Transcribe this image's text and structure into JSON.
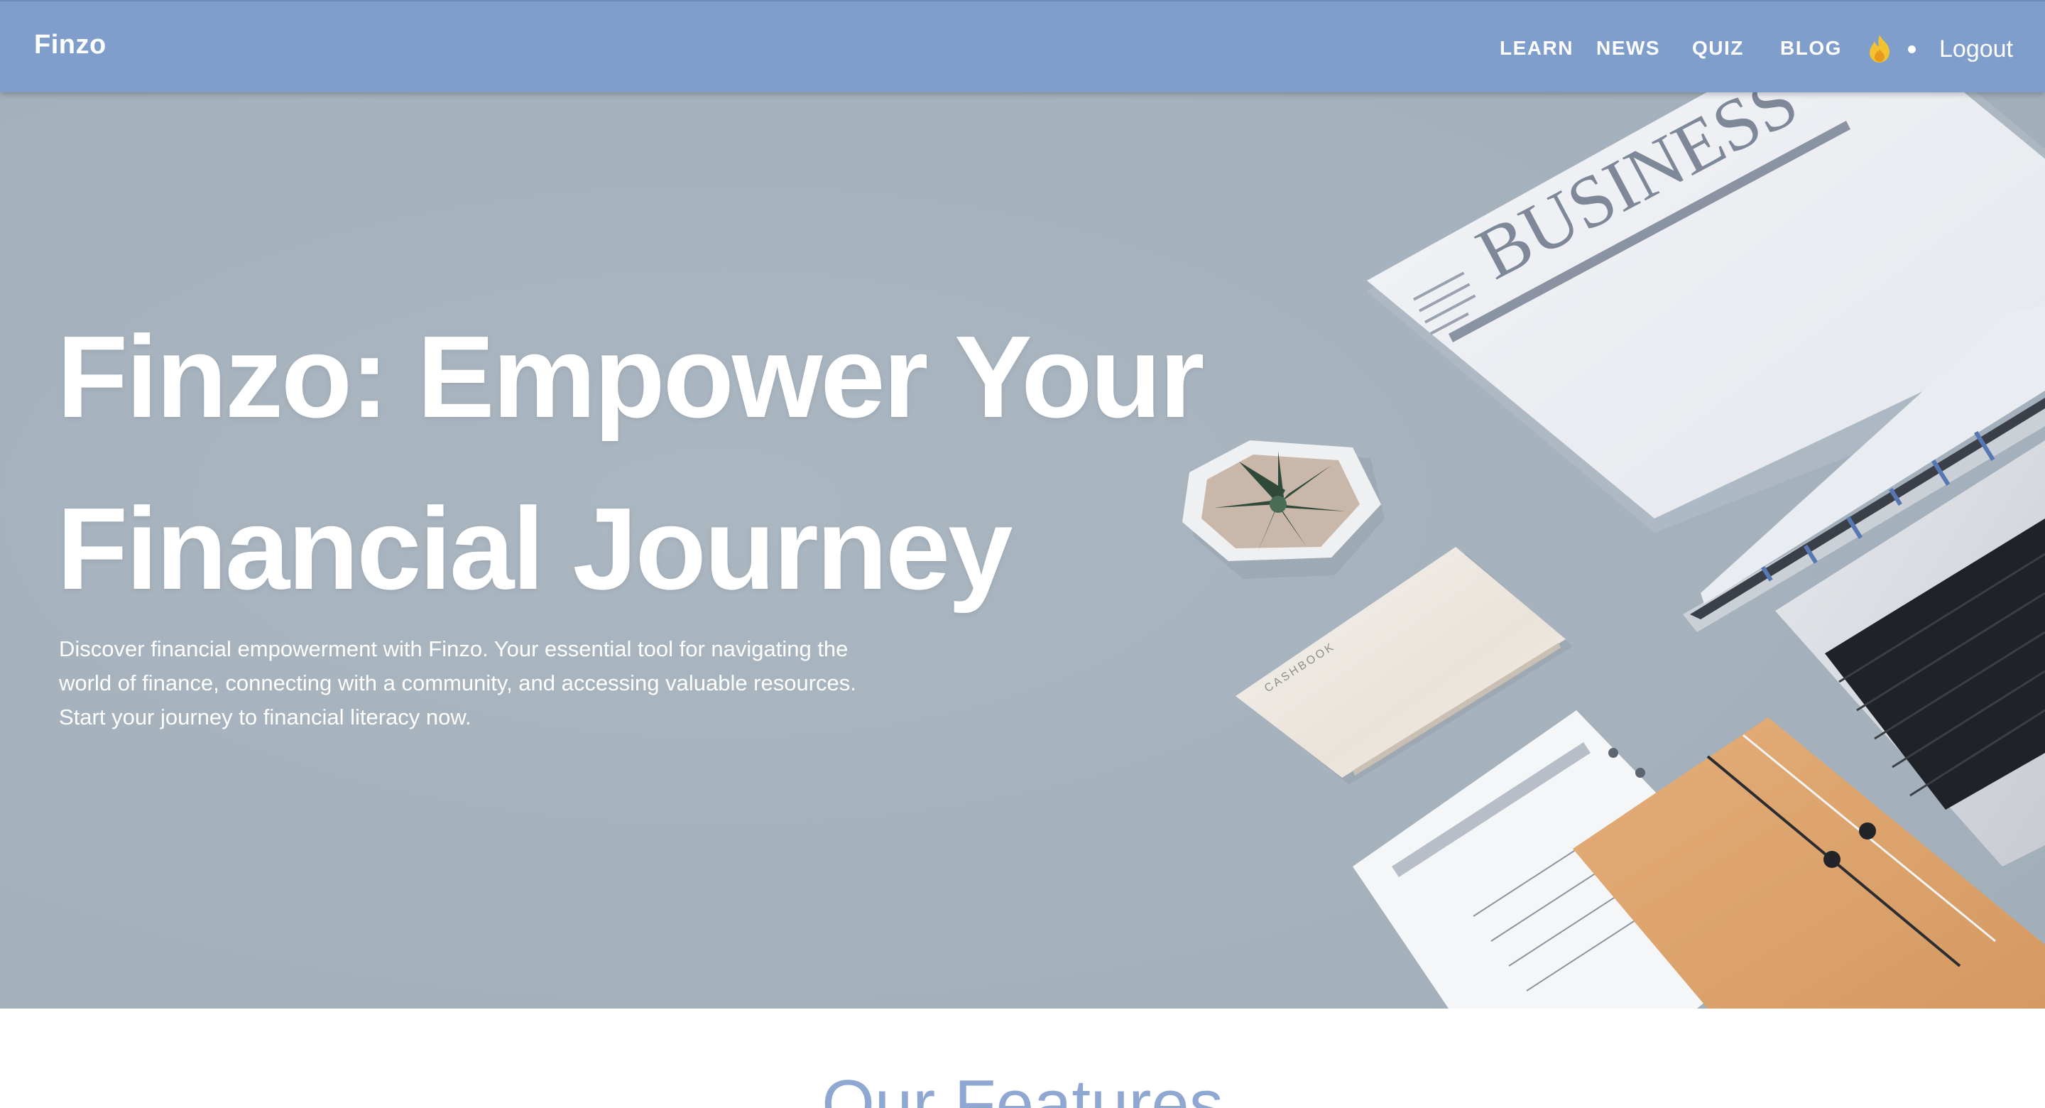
{
  "navbar": {
    "brand": "Finzo",
    "links": [
      "LEARN",
      "NEWS",
      "QUIZ",
      "BLOG"
    ],
    "streak_icon": "flame-icon",
    "separator_icon": "dot-icon",
    "logout_label": "Logout"
  },
  "hero": {
    "title_line1": "Finzo: Empower Your",
    "title_line2": "Financial Journey",
    "description": "Discover financial empowerment with Finzo. Your essential tool for navigating the world of finance, connecting with a community, and accessing valuable resources. Start your journey to financial literacy now.",
    "image_text": {
      "newspaper_headline": "BUSINESS",
      "cashbook_label": "CASHBOOK"
    }
  },
  "features": {
    "title": "Our Features"
  },
  "colors": {
    "navbar": "#7f9ecb",
    "hero_background": "#a6b3bd",
    "features_title": "#8fa8d2",
    "flame": "#f2c230"
  }
}
